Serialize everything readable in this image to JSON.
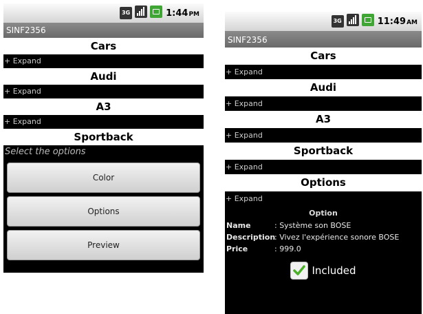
{
  "left": {
    "status": {
      "icon_3g": "3G",
      "time": "1:44",
      "ampm": "PM"
    },
    "title": "SINF2356",
    "sections": [
      {
        "title": "Cars",
        "expand": "+ Expand"
      },
      {
        "title": "Audi",
        "expand": "+ Expand"
      },
      {
        "title": "A3",
        "expand": "+ Expand"
      },
      {
        "title": "Sportback"
      }
    ],
    "select_label": "Select the options",
    "buttons": [
      "Color",
      "Options",
      "Preview"
    ]
  },
  "right": {
    "status": {
      "icon_3g": "3G",
      "time": "11:49",
      "ampm": "AM"
    },
    "title": "SINF2356",
    "sections": [
      {
        "title": "Cars",
        "expand": "+ Expand"
      },
      {
        "title": "Audi",
        "expand": "+ Expand"
      },
      {
        "title": "A3",
        "expand": "+ Expand"
      },
      {
        "title": "Sportback",
        "expand": "+ Expand"
      },
      {
        "title": "Options",
        "expand": "+ Expand"
      }
    ],
    "option": {
      "heading": "Option",
      "name_label": "Name",
      "name_value": ": Système son BOSE",
      "description_label": "Description",
      "description_value": ": Vivez l'expérience sonore BOSE",
      "price_label": "Price",
      "price_value": ": 999.0",
      "included_label": "Included",
      "included_checked": true
    }
  },
  "colors": {
    "accent_check": "#4caf2a",
    "battery": "#3fa535"
  }
}
